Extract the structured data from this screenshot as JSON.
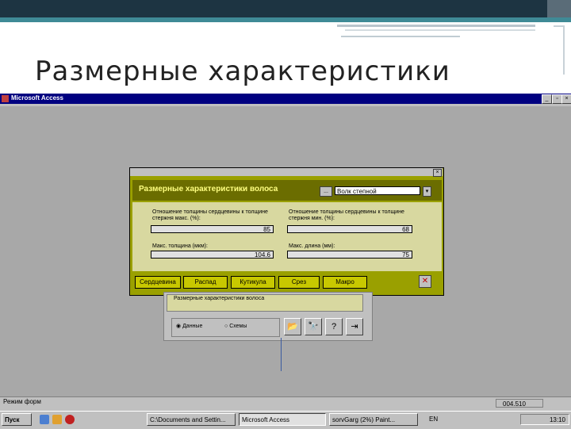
{
  "slide": {
    "title": "Размерные характеристики"
  },
  "access": {
    "title": "Microsoft Access",
    "min": "_",
    "restore": "▫",
    "close": "×",
    "status": "Режим форм"
  },
  "dialog": {
    "title": "Размерные характеристики волоса",
    "more_button": "...",
    "hair_type": "Волк степной",
    "close": "×",
    "fields": [
      {
        "label": "Отношение толщины сердцевины к толщине стержня макс. (%):",
        "value": "85"
      },
      {
        "label": "Отношение толщины сердцевины к толщине стержня мин. (%):",
        "value": "68"
      },
      {
        "label": "Макс. толщина (мкм):",
        "value": "104.6"
      },
      {
        "label": "Макс. длина (мм):",
        "value": "75"
      }
    ],
    "buttons": [
      "Сердцевина",
      "Распад",
      "Кутикула",
      "Срез",
      "Макро"
    ]
  },
  "switchboard": {
    "title": "Размерные характеристики волоса",
    "radio_data": "Данные",
    "radio_schemes": "Схемы"
  },
  "statusbar": {
    "coords": "004.510"
  },
  "taskbar": {
    "start": "Пуск",
    "items": [
      "C:\\Documents and Settin...",
      "Microsoft Access",
      "sorvGarg (2%) Paint..."
    ],
    "lang": "EN",
    "clock": "13:10"
  },
  "colors": {
    "dialog_olive": "#9aa000",
    "header_dark": "#6b6d00",
    "titlebar": "#000080"
  }
}
